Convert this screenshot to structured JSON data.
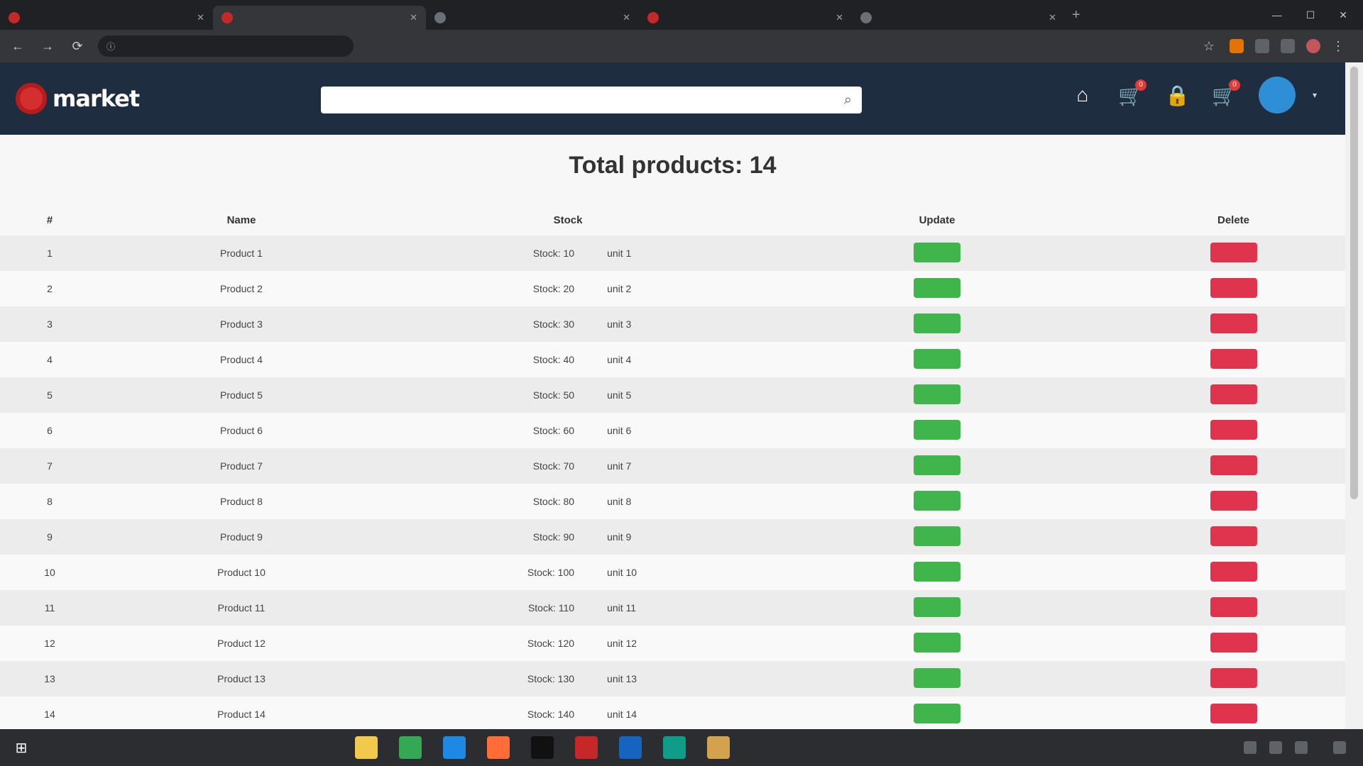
{
  "browser": {
    "tabs": [
      {
        "title": "",
        "active": false
      },
      {
        "title": "",
        "active": true
      },
      {
        "title": "",
        "active": false
      },
      {
        "title": "",
        "active": false
      },
      {
        "title": "",
        "active": false
      }
    ],
    "new_tab_label": "+",
    "url": "",
    "window_controls": {
      "minimize": "—",
      "maximize": "☐",
      "close": "✕"
    }
  },
  "app": {
    "logo_text": "market",
    "logo_sub": "",
    "search": {
      "placeholder": "",
      "value": ""
    },
    "header_icons": [
      {
        "name": "home-icon",
        "glyph": "⌂",
        "badge": ""
      },
      {
        "name": "cart-icon",
        "glyph": "🛒",
        "badge": "0"
      },
      {
        "name": "lock-icon",
        "glyph": "🔒",
        "badge": ""
      },
      {
        "name": "cart-icon",
        "glyph": "🛒",
        "badge": "0"
      }
    ],
    "user": {
      "name": "",
      "caret": "▾"
    }
  },
  "main": {
    "title": "Total products: 14",
    "columns": [
      "#",
      "Name",
      "Stock",
      "Update",
      "Delete"
    ],
    "rows": [
      {
        "num": "1",
        "name": "Product 1",
        "stock": "Stock: 10",
        "unit": "unit 1",
        "update": "",
        "delete": ""
      },
      {
        "num": "2",
        "name": "Product 2",
        "stock": "Stock: 20",
        "unit": "unit 2",
        "update": "",
        "delete": ""
      },
      {
        "num": "3",
        "name": "Product 3",
        "stock": "Stock: 30",
        "unit": "unit 3",
        "update": "",
        "delete": ""
      },
      {
        "num": "4",
        "name": "Product 4",
        "stock": "Stock: 40",
        "unit": "unit 4",
        "update": "",
        "delete": ""
      },
      {
        "num": "5",
        "name": "Product 5",
        "stock": "Stock: 50",
        "unit": "unit 5",
        "update": "",
        "delete": ""
      },
      {
        "num": "6",
        "name": "Product 6",
        "stock": "Stock: 60",
        "unit": "unit 6",
        "update": "",
        "delete": ""
      },
      {
        "num": "7",
        "name": "Product 7",
        "stock": "Stock: 70",
        "unit": "unit 7",
        "update": "",
        "delete": ""
      },
      {
        "num": "8",
        "name": "Product 8",
        "stock": "Stock: 80",
        "unit": "unit 8",
        "update": "",
        "delete": ""
      },
      {
        "num": "9",
        "name": "Product 9",
        "stock": "Stock: 90",
        "unit": "unit 9",
        "update": "",
        "delete": ""
      },
      {
        "num": "10",
        "name": "Product 10",
        "stock": "Stock: 100",
        "unit": "unit 10",
        "update": "",
        "delete": ""
      },
      {
        "num": "11",
        "name": "Product 11",
        "stock": "Stock: 110",
        "unit": "unit 11",
        "update": "",
        "delete": ""
      },
      {
        "num": "12",
        "name": "Product 12",
        "stock": "Stock: 120",
        "unit": "unit 12",
        "update": "",
        "delete": ""
      },
      {
        "num": "13",
        "name": "Product 13",
        "stock": "Stock: 130",
        "unit": "unit 13",
        "update": "",
        "delete": ""
      },
      {
        "num": "14",
        "name": "Product 14",
        "stock": "Stock: 140",
        "unit": "unit 14",
        "update": "",
        "delete": ""
      }
    ]
  },
  "taskbar": {
    "start_glyph": "⊞",
    "apps": [
      {
        "name": "file-explorer-icon",
        "color": "#f2c94c"
      },
      {
        "name": "chrome-icon",
        "color": "#34a853"
      },
      {
        "name": "vscode-icon",
        "color": "#1e88e5"
      },
      {
        "name": "postman-icon",
        "color": "#ff6c37"
      },
      {
        "name": "terminal-icon",
        "color": "#111111"
      },
      {
        "name": "opera-icon",
        "color": "#c62828"
      },
      {
        "name": "settings-icon",
        "color": "#1565c0"
      },
      {
        "name": "edge-icon",
        "color": "#0f9d8a"
      },
      {
        "name": "photos-icon",
        "color": "#d4a24c"
      }
    ],
    "clock_time": "",
    "clock_date": ""
  },
  "colors": {
    "appbar": "#1e2d3f",
    "update_button": "#3fb54b",
    "delete_button": "#e0344e",
    "brand": "#d32f2f"
  }
}
